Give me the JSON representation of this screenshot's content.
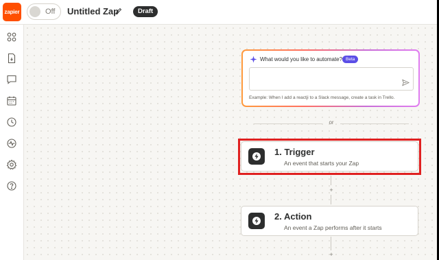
{
  "app": {
    "logo_text": "zapier",
    "toggle_label": "Off",
    "zap_title": "Untitled Zap",
    "status_badge": "Draft"
  },
  "sidebar": {
    "items": [
      {
        "icon": "apps-icon"
      },
      {
        "icon": "file-icon"
      },
      {
        "icon": "comment-icon"
      },
      {
        "icon": "calendar-icon"
      },
      {
        "icon": "history-icon"
      },
      {
        "icon": "activity-icon"
      },
      {
        "icon": "settings-icon"
      },
      {
        "icon": "help-icon"
      }
    ]
  },
  "copilot": {
    "question": "What would you like to automate?",
    "badge": "Beta",
    "input_value": "",
    "example": "Example: When I add a reactji to a Slack message, create a task in Trello."
  },
  "divider": {
    "text": "or"
  },
  "steps": [
    {
      "title": "1. Trigger",
      "subtitle": "An event that starts your Zap"
    },
    {
      "title": "2. Action",
      "subtitle": "An event a Zap performs after it starts"
    }
  ],
  "connectors": {
    "add_symbol": "+"
  },
  "colors": {
    "brand": "#ff4f00",
    "highlight": "#e02020",
    "beta": "#5b4ee6",
    "dark": "#2d2e2e"
  }
}
